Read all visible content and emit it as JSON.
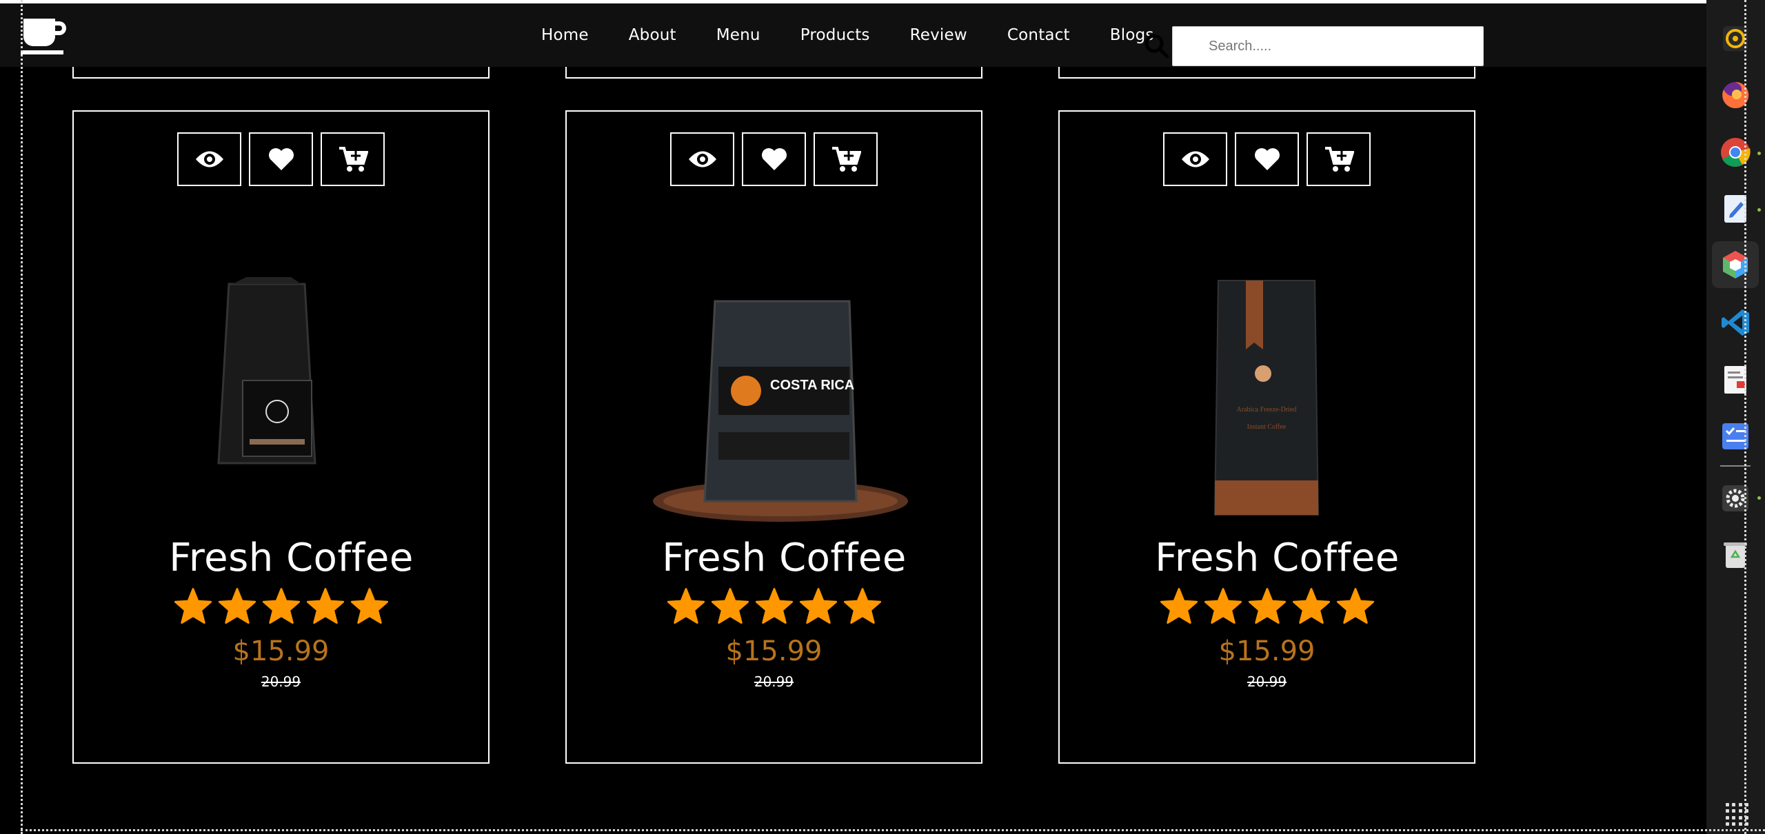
{
  "nav": {
    "items": [
      "Home",
      "About",
      "Menu",
      "Products",
      "Review",
      "Contact",
      "Blogs"
    ]
  },
  "search": {
    "placeholder": "Search....."
  },
  "products": [
    {
      "title": "Fresh Coffee",
      "price": "$15.99",
      "old_price": "20.99",
      "rating": 5,
      "bag": "black-bag"
    },
    {
      "title": "Fresh Coffee",
      "price": "$15.99",
      "old_price": "20.99",
      "rating": 5,
      "bag": "costa-rica-bag"
    },
    {
      "title": "Fresh Coffee",
      "price": "$15.99",
      "old_price": "20.99",
      "rating": 5,
      "bag": "brown-bag"
    }
  ],
  "colors": {
    "accent_star": "#ff9800",
    "price": "#b8731c",
    "background": "#000000"
  },
  "dock": {
    "apps": [
      "record-icon",
      "firefox-icon",
      "chrome-icon",
      "text-editor-icon",
      "3d-app-icon",
      "vscode-icon",
      "document-viewer-icon",
      "todo-icon",
      "settings-icon",
      "trash-icon"
    ]
  }
}
